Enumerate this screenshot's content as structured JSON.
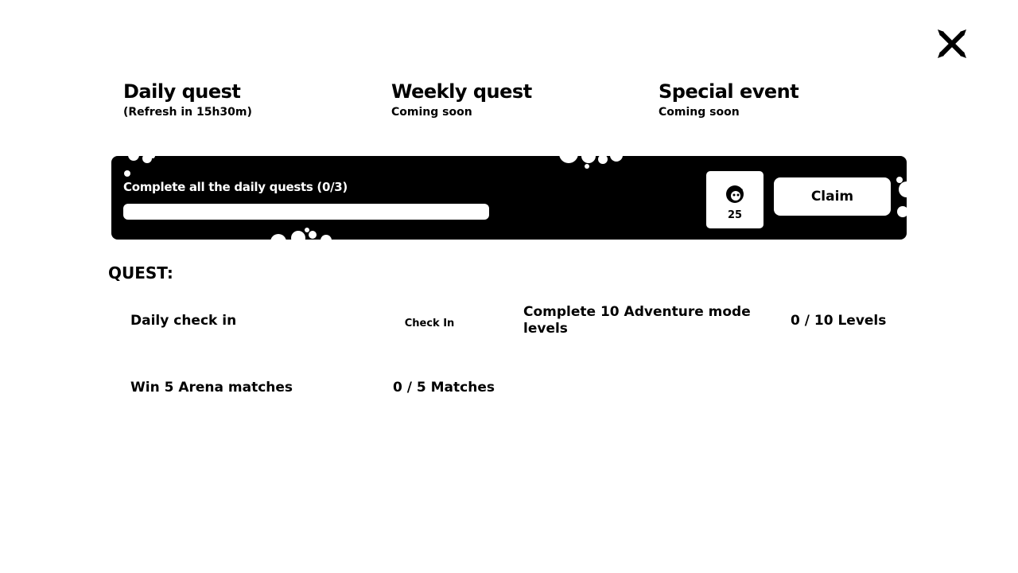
{
  "close_icon": "close-x-icon",
  "tabs": [
    {
      "title": "Daily quest",
      "subtitle": "(Refresh in 15h30m)"
    },
    {
      "title": "Weekly quest",
      "subtitle": "Coming soon"
    },
    {
      "title": "Special event",
      "subtitle": "Coming soon"
    }
  ],
  "banner": {
    "text": "Complete all the daily quests (0/3)",
    "progress_fraction": 0,
    "reward_icon": "character-token-icon",
    "reward_amount": "25",
    "claim_label": "Claim"
  },
  "quest_section_title": "QUEST:",
  "quests": [
    {
      "name": "Daily check in",
      "action_label": "Check In"
    },
    {
      "name": "Complete 10 Adventure mode levels",
      "progress": "0 / 10 Levels"
    },
    {
      "name": "Win 5 Arena matches",
      "progress": "0 / 5 Matches"
    }
  ]
}
